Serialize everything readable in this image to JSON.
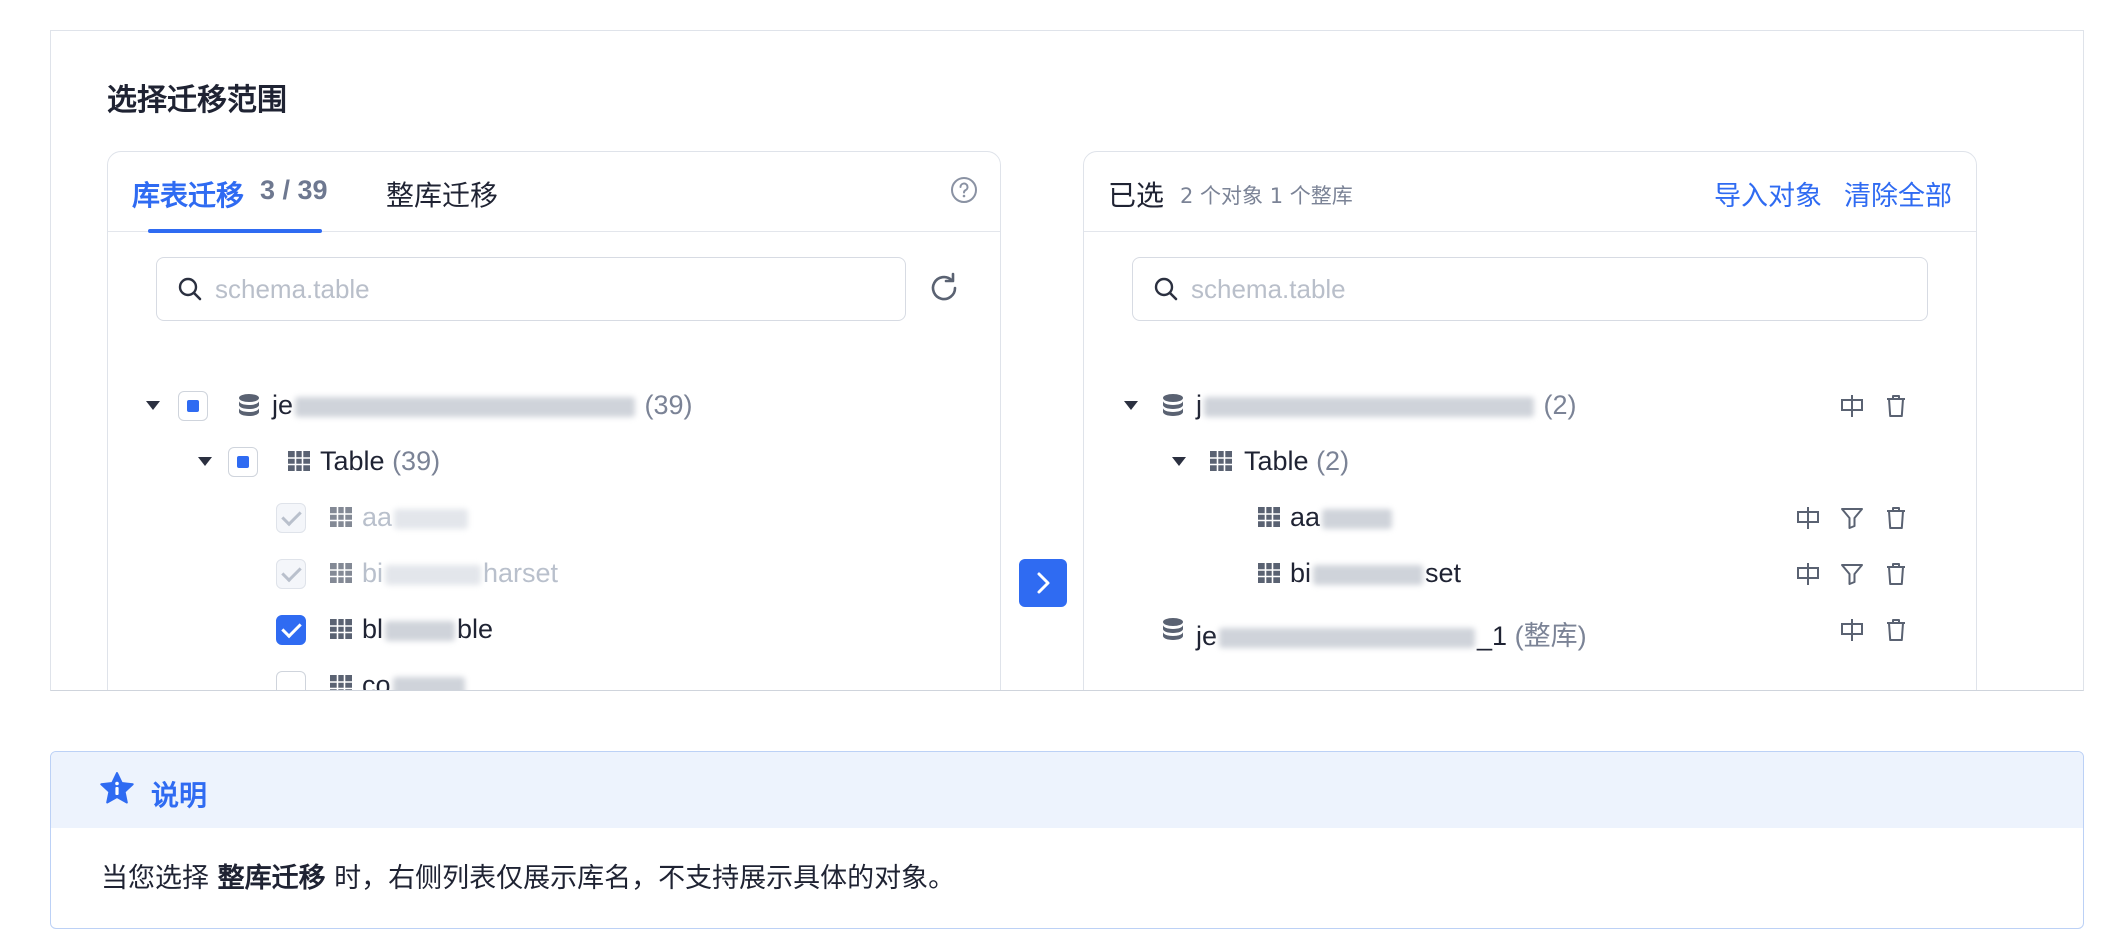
{
  "card": {
    "title": "选择迁移范围"
  },
  "left_panel": {
    "tab_table": "库表迁移",
    "tab_count": "3 / 39",
    "tab_whole": "整库迁移",
    "search_placeholder": "schema.table",
    "tree": {
      "db": {
        "prefix": "je",
        "count": "(39)"
      },
      "group": {
        "label": "Table",
        "count": "(39)"
      },
      "items": [
        {
          "prefix": "aa",
          "suffix": "",
          "state": "disabled"
        },
        {
          "prefix": "bi",
          "suffix": "harset",
          "state": "disabled"
        },
        {
          "prefix": "bl",
          "suffix": "ble",
          "state": "checked"
        },
        {
          "prefix": "co",
          "suffix": "",
          "state": "unchecked"
        }
      ]
    }
  },
  "right_panel": {
    "selected_label": "已选",
    "selected_summary": "2 个对象 1 个整库",
    "import_label": "导入对象",
    "clear_label": "清除全部",
    "search_placeholder": "schema.table",
    "tree": {
      "db1": {
        "prefix": "j",
        "count": "(2)"
      },
      "group": {
        "label": "Table",
        "count": "(2)"
      },
      "items": [
        {
          "prefix": "aa",
          "suffix": ""
        },
        {
          "prefix": "bi",
          "suffix": "set"
        }
      ],
      "db2": {
        "prefix": "je",
        "suffix": "_1",
        "tag": "(整库)"
      }
    }
  },
  "note": {
    "title": "说明",
    "text_before": "当您选择 ",
    "text_bold": "整库迁移",
    "text_after": " 时，右侧列表仅展示库名，不支持展示具体的对象。"
  },
  "colors": {
    "accent": "#2f6bf2",
    "border": "#dfe3ea",
    "note_bg": "#edf3fd"
  }
}
